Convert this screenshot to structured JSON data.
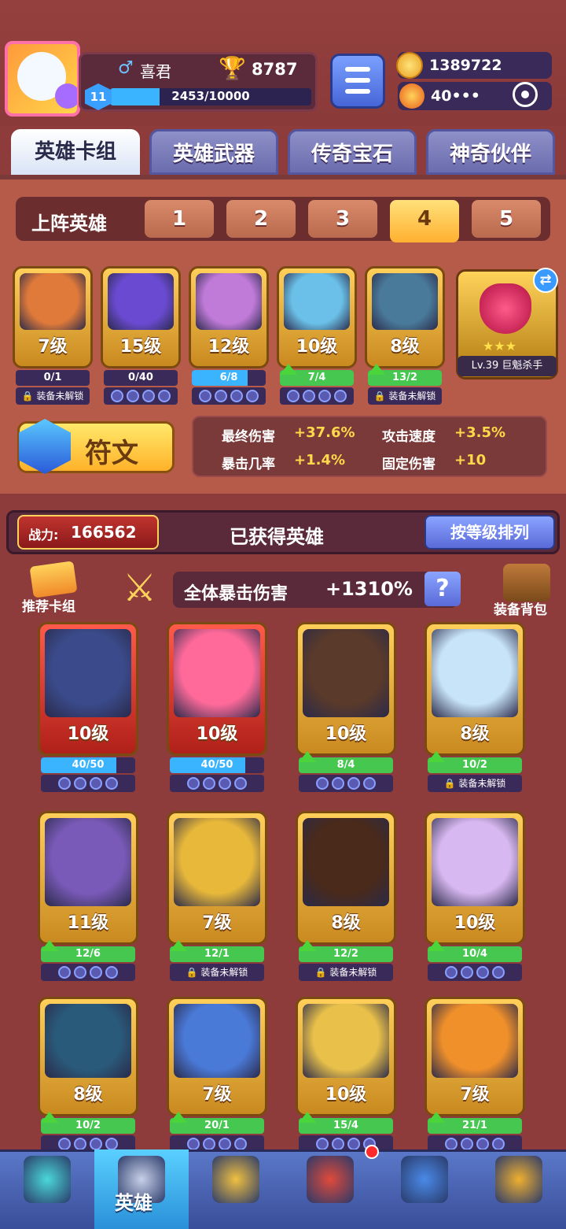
{
  "player": {
    "name": "喜君",
    "gender_symbol": "♂",
    "trophies": "8787",
    "level": "11",
    "xp_text": "2453/10000",
    "xp_fraction": 0.2453
  },
  "currency": {
    "coins": "1389722",
    "energy": "40•••"
  },
  "tabs": [
    {
      "label": "英雄卡组",
      "active": true
    },
    {
      "label": "英雄武器",
      "active": false
    },
    {
      "label": "传奇宝石",
      "active": false
    },
    {
      "label": "神奇伙伴",
      "active": false
    }
  ],
  "lineup": {
    "label": "上阵英雄",
    "slots": [
      "1",
      "2",
      "3",
      "4",
      "5"
    ],
    "active_slot": "4"
  },
  "lineup_heroes": [
    {
      "level": "7级",
      "bar_text": "0/1",
      "bar_fraction": 0,
      "bar_color": "blue",
      "upgrade": false,
      "gear_text": "装备未解锁",
      "art": "#e07a3a"
    },
    {
      "level": "15级",
      "bar_text": "0/40",
      "bar_fraction": 0,
      "bar_color": "blue",
      "upgrade": false,
      "gear_text": "",
      "art": "#6a4ad0"
    },
    {
      "level": "12级",
      "bar_text": "6/8",
      "bar_fraction": 0.75,
      "bar_color": "blue",
      "upgrade": false,
      "gear_text": "",
      "art": "#c07ad8"
    },
    {
      "level": "10级",
      "bar_text": "7/4",
      "bar_fraction": 1,
      "bar_color": "green",
      "upgrade": true,
      "gear_text": "",
      "art": "#6ac0e8"
    },
    {
      "level": "8级",
      "bar_text": "13/2",
      "bar_fraction": 1,
      "bar_color": "green",
      "upgrade": true,
      "gear_text": "装备未解锁",
      "art": "#4a7a9a"
    }
  ],
  "gem": {
    "label": "Lv.39 巨魁杀手",
    "stars": "★★★"
  },
  "rune": {
    "label": "符文"
  },
  "stats": [
    {
      "label": "最终伤害",
      "value": "+37.6%"
    },
    {
      "label": "攻击速度",
      "value": "+3.5%"
    },
    {
      "label": "暴击几率",
      "value": "+1.4%"
    },
    {
      "label": "固定伤害",
      "value": "+10"
    }
  ],
  "power": {
    "label": "战力:",
    "value": "166562"
  },
  "collection": {
    "title": "已获得英雄",
    "sort_label": "按等级排列",
    "deck_label": "推荐卡组",
    "bag_label": "装备背包",
    "crit_label": "全体暴击伤害",
    "crit_value": "+1310%",
    "help": "?"
  },
  "heroes": [
    {
      "level": "10级",
      "bar_text": "40/50",
      "bar_fraction": 0.8,
      "bar_color": "blue",
      "upgrade": false,
      "gear_text": "",
      "frame": "red",
      "art": "#3a4a8a"
    },
    {
      "level": "10级",
      "bar_text": "40/50",
      "bar_fraction": 0.8,
      "bar_color": "blue",
      "upgrade": false,
      "gear_text": "",
      "frame": "red",
      "art": "#ff6a9a"
    },
    {
      "level": "10级",
      "bar_text": "8/4",
      "bar_fraction": 1,
      "bar_color": "green",
      "upgrade": true,
      "gear_text": "",
      "frame": "gold",
      "art": "#5a3a2a"
    },
    {
      "level": "8级",
      "bar_text": "10/2",
      "bar_fraction": 1,
      "bar_color": "green",
      "upgrade": true,
      "gear_text": "装备未解锁",
      "frame": "gold",
      "art": "#c8e4f8"
    },
    {
      "level": "11级",
      "bar_text": "12/6",
      "bar_fraction": 1,
      "bar_color": "green",
      "upgrade": true,
      "gear_text": "",
      "frame": "gold",
      "art": "#7a5ab8"
    },
    {
      "level": "7级",
      "bar_text": "12/1",
      "bar_fraction": 1,
      "bar_color": "green",
      "upgrade": true,
      "gear_text": "装备未解锁",
      "frame": "gold",
      "art": "#e8b83a"
    },
    {
      "level": "8级",
      "bar_text": "12/2",
      "bar_fraction": 1,
      "bar_color": "green",
      "upgrade": true,
      "gear_text": "装备未解锁",
      "frame": "gold",
      "art": "#4a2a1a"
    },
    {
      "level": "10级",
      "bar_text": "10/4",
      "bar_fraction": 1,
      "bar_color": "green",
      "upgrade": true,
      "gear_text": "",
      "frame": "gold",
      "art": "#d8b8f0"
    },
    {
      "level": "8级",
      "bar_text": "10/2",
      "bar_fraction": 1,
      "bar_color": "green",
      "upgrade": true,
      "gear_text": "",
      "frame": "gold",
      "art": "#2a5a7a"
    },
    {
      "level": "7级",
      "bar_text": "20/1",
      "bar_fraction": 1,
      "bar_color": "green",
      "upgrade": true,
      "gear_text": "",
      "frame": "gold",
      "art": "#4a7ad8"
    },
    {
      "level": "10级",
      "bar_text": "15/4",
      "bar_fraction": 1,
      "bar_color": "green",
      "upgrade": true,
      "gear_text": "",
      "frame": "gold",
      "art": "#e8c04a"
    },
    {
      "level": "7级",
      "bar_text": "21/1",
      "bar_fraction": 1,
      "bar_color": "green",
      "upgrade": true,
      "gear_text": "",
      "frame": "gold",
      "art": "#f0902a"
    }
  ],
  "nav": [
    {
      "icon": "treasure-chest-icon",
      "label": "",
      "active": false,
      "badge": false
    },
    {
      "icon": "knight-helmet-icon",
      "label": "英雄",
      "active": true,
      "badge": false
    },
    {
      "icon": "crossed-swords-icon",
      "label": "",
      "active": false,
      "badge": false
    },
    {
      "icon": "crown-shield-icon",
      "label": "",
      "active": false,
      "badge": true
    },
    {
      "icon": "guild-banner-icon",
      "label": "",
      "active": false,
      "badge": false
    },
    {
      "icon": "compass-icon",
      "label": "",
      "active": false,
      "badge": false
    }
  ]
}
